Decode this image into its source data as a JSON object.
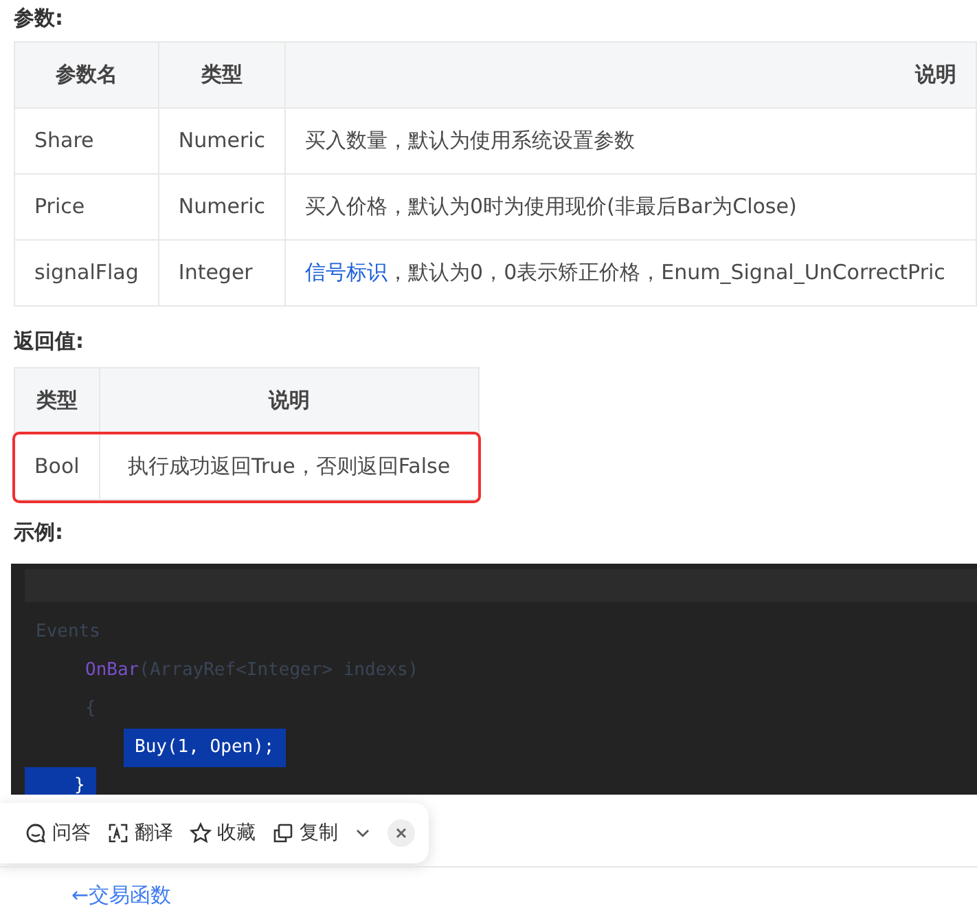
{
  "params_heading": "参数:",
  "params_table": {
    "columns": [
      "参数名",
      "类型",
      "说明"
    ],
    "rows": [
      {
        "cells": [
          "Share",
          "Numeric"
        ],
        "description": {
          "text": "买入数量，默认为使用系统设置参数"
        }
      },
      {
        "cells": [
          "Price",
          "Numeric"
        ],
        "description": {
          "text": "买入价格，默认为0时为使用现价(非最后Bar为Close)"
        }
      },
      {
        "cells": [
          "signalFlag",
          "Integer"
        ],
        "description": {
          "link": "信号标识",
          "text": "，默认为0，0表示矫正价格，Enum_Signal_UnCorrectPric"
        }
      }
    ]
  },
  "return_heading": "返回值:",
  "return_table": {
    "columns": [
      "类型",
      "说明"
    ],
    "rows": [
      {
        "cells": [
          "Bool",
          "执行成功返回True，否则返回False"
        ],
        "highlighted": true
      }
    ]
  },
  "example_heading": "示例:",
  "code_lines": [
    {
      "parts": [
        {
          "text": "Events",
          "kind": "dim"
        }
      ],
      "selected": false,
      "children": [
        {
          "parts": [
            {
              "text": "OnBar",
              "kind": "func"
            },
            {
              "text": "(ArrayRef<Integer> indexs)",
              "kind": "dim"
            }
          ],
          "selected": false
        },
        {
          "parts": [
            {
              "text": "{",
              "kind": "dim"
            }
          ],
          "selected": false,
          "children": [
            {
              "parts": [
                {
                  "text": "Buy(1, Open);",
                  "kind": "plain"
                }
              ],
              "selected": true
            }
          ]
        },
        {
          "parts": [
            {
              "text": "}",
              "kind": "plain"
            }
          ],
          "selected": true
        }
      ]
    }
  ],
  "toolbar": {
    "items": [
      {
        "label": "问答"
      },
      {
        "label": "翻译"
      },
      {
        "label": "收藏"
      },
      {
        "label": "复制"
      }
    ]
  },
  "back_link": "←交易函数"
}
